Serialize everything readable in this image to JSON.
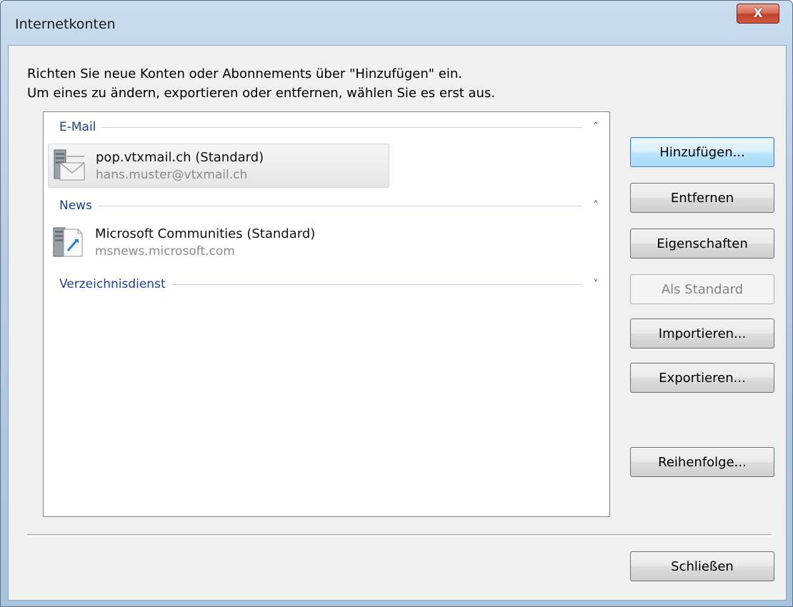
{
  "window": {
    "title": "Internetkonten",
    "close_glyph": "X"
  },
  "instructions": {
    "line1": "Richten Sie neue Konten oder Abonnements über \"Hinzufügen\" ein.",
    "line2": "Um eines zu ändern, exportieren oder entfernen, wählen Sie es erst aus."
  },
  "groups": [
    {
      "label": "E-Mail",
      "chevron": "˄",
      "expanded": true,
      "accounts": [
        {
          "name": "pop.vtxmail.ch (Standard)",
          "detail": "hans.muster@vtxmail.ch",
          "icon": "mail-server-icon",
          "selected": true
        }
      ]
    },
    {
      "label": "News",
      "chevron": "˄",
      "expanded": true,
      "accounts": [
        {
          "name": "Microsoft Communities (Standard)",
          "detail": "msnews.microsoft.com",
          "icon": "news-server-icon",
          "selected": false
        }
      ]
    },
    {
      "label": "Verzeichnisdienst",
      "chevron": "˅",
      "expanded": false,
      "accounts": []
    }
  ],
  "buttons": {
    "add": "Hinzufügen...",
    "remove": "Entfernen",
    "properties": "Eigenschaften",
    "set_default": "Als Standard",
    "import": "Importieren...",
    "export": "Exportieren...",
    "order": "Reihenfolge...",
    "close": "Schließen"
  },
  "colors": {
    "group_header": "#1e3f93",
    "titlebar": "#b6cde6",
    "default_button_border": "#3c7fb1"
  }
}
